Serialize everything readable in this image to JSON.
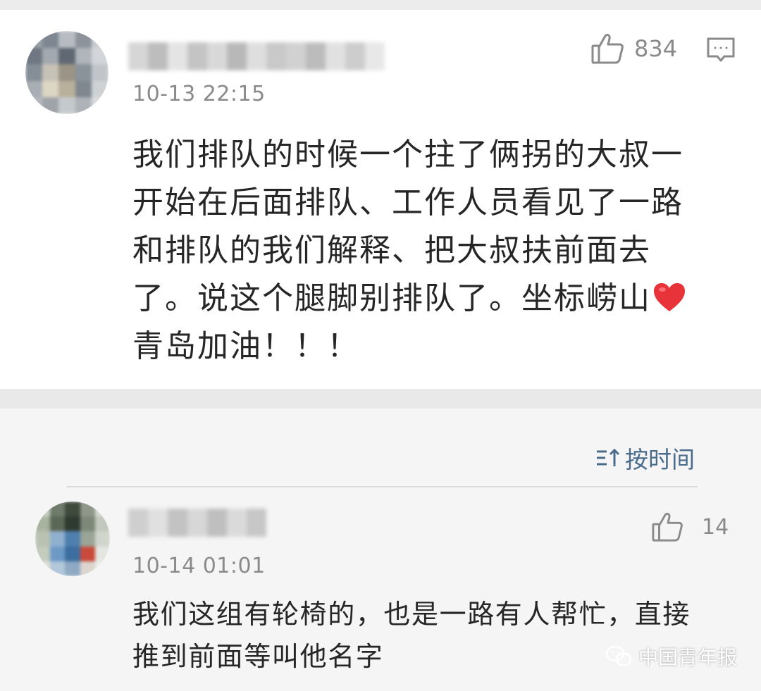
{
  "comments": [
    {
      "timestamp": "10-13 22:15",
      "likes": "834",
      "text_lines": [
        "我们排队的时候一个拄了俩拐的大叔一",
        "开始在后面排队、工作人员看见了一路",
        "和排队的我们解释、把大叔扶前面去",
        "了。说这个腿脚别排队了。坐标崂山",
        "青岛加油！！！"
      ],
      "emoji": "red-heart",
      "actions": {
        "like_icon": "thumb-up-icon",
        "reply_icon": "comment-icon"
      }
    },
    {
      "timestamp": "10-14 01:01",
      "likes": "14",
      "text_lines": [
        "我们这组有轮椅的，也是一路有人帮忙，直接",
        "推到前面等叫他名字"
      ],
      "actions": {
        "like_icon": "thumb-up-icon"
      }
    }
  ],
  "sort": {
    "label": "按时间",
    "icon": "sort-icon"
  },
  "watermark": {
    "text": "中国青年报",
    "icon": "wechat-icon"
  },
  "colors": {
    "accent_link": "#4a6c8c",
    "muted": "#8a8a8a",
    "text": "#262626",
    "heart": "#e8333a"
  }
}
